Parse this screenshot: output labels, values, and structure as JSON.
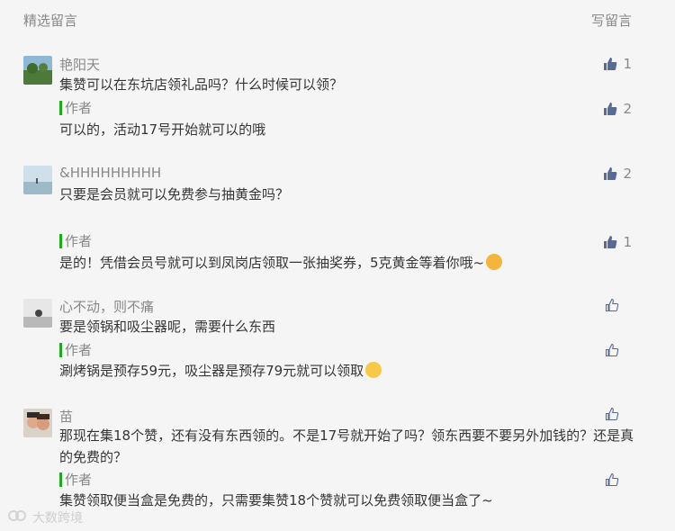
{
  "header": {
    "title": "精选留言",
    "write_label": "写留言"
  },
  "comments": [
    {
      "nickname": "艳阳天",
      "content": "集赞可以在东坑店领礼品吗？什么时候可以领？",
      "likes": "1",
      "reply": {
        "tag": "作者",
        "content": "可以的，活动17号开始就可以的哦",
        "likes": "2"
      }
    },
    {
      "nickname": "&HHHHHHHHH",
      "content": "只要是会员就可以免费参与抽黄金吗？",
      "likes": "2",
      "reply": {
        "tag": "作者",
        "content": "是的！凭借会员号就可以到凤岗店领取一张抽奖券，5克黄金等着你哦~",
        "likes": "1"
      }
    },
    {
      "nickname": "心不动，则不痛",
      "content": "要是领锅和吸尘器呢，需要什么东西",
      "likes": "",
      "reply": {
        "tag": "作者",
        "content": "涮烤锅是预存59元，吸尘器是预存79元就可以领取",
        "likes": ""
      }
    },
    {
      "nickname": "苗",
      "content": "那现在集18个赞，还有没有东西领的。不是17号就开始了吗？领东西要不要另外加钱的？还是真的免费的？",
      "likes": "",
      "reply": {
        "tag": "作者",
        "content": "集赞领取便当盒是免费的，只需要集赞18个赞就可以免费领取便当盒了~",
        "likes": ""
      }
    }
  ],
  "watermark": {
    "text": "大数跨境"
  },
  "colors": {
    "accent": "#1aad19",
    "text": "#353535",
    "muted": "#888888",
    "like_filled": "#576b95"
  }
}
